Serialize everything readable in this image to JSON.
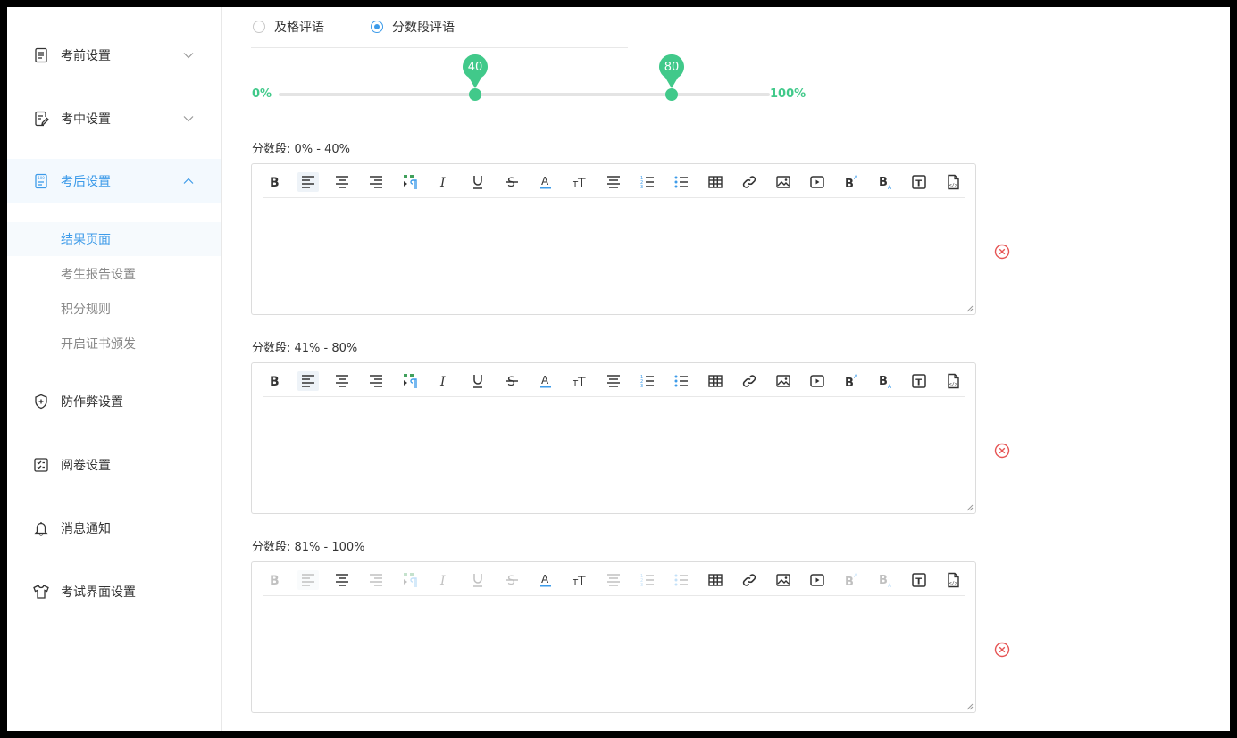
{
  "sidebar": {
    "menu": [
      {
        "label": "考前设置",
        "icon": "doc-list-icon",
        "expanded": false
      },
      {
        "label": "考中设置",
        "icon": "doc-edit-icon",
        "expanded": false
      },
      {
        "label": "考后设置",
        "icon": "score-sheet-icon",
        "expanded": true,
        "active": true
      },
      {
        "label": "防作弊设置",
        "icon": "shield-plus-icon"
      },
      {
        "label": "阅卷设置",
        "icon": "checklist-icon"
      },
      {
        "label": "消息通知",
        "icon": "bell-icon"
      },
      {
        "label": "考试界面设置",
        "icon": "tshirt-icon"
      }
    ],
    "sub_items": [
      "结果页面",
      "考生报告设置",
      "积分规则",
      "开启证书颁发"
    ],
    "active_sub": "结果页面"
  },
  "comment_type": {
    "options": [
      "及格评语",
      "分数段评语"
    ],
    "selected": "分数段评语"
  },
  "slider": {
    "min_label": "0%",
    "max_label": "100%",
    "thumbs": [
      40,
      80
    ],
    "min": 0,
    "max": 100
  },
  "segments": [
    {
      "label": "分数段: 0% - 40%"
    },
    {
      "label": "分数段: 41% - 80%"
    },
    {
      "label": "分数段: 81% - 100%"
    }
  ],
  "colors": {
    "accent": "#3d9be9",
    "slider": "#41c98a",
    "delete": "#e65454"
  }
}
